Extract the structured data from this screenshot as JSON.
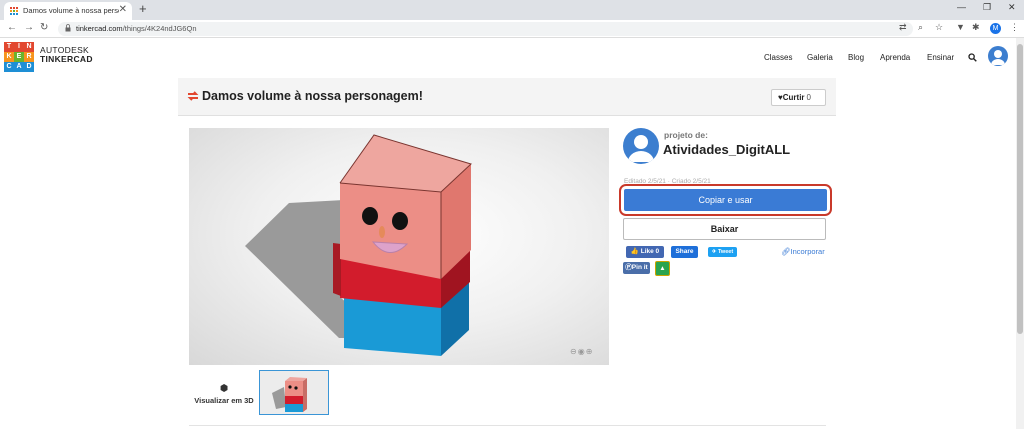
{
  "browser": {
    "tab_title": "Damos volume à nossa personag",
    "close_glyph": "✕",
    "new_tab_glyph": "+",
    "url_host": "tinkercad.com",
    "url_path": "/things/4K24ndJG6Qn",
    "profile_initial": "M",
    "window_controls": [
      "—",
      "❐",
      "✕"
    ]
  },
  "site": {
    "logo_letters": [
      "T",
      "I",
      "N",
      "K",
      "E",
      "R",
      "C",
      "A",
      "D"
    ],
    "logo_colors": [
      "#e2472f",
      "#e2472f",
      "#e2472f",
      "#f7941d",
      "#6ab42d",
      "#f7941d",
      "#1e8fd5",
      "#1e8fd5",
      "#1e8fd5"
    ],
    "brand_line1": "AUTODESK",
    "brand_line2": "TINKERCAD",
    "nav": [
      "Classes",
      "Galeria",
      "Blog",
      "Aprenda",
      "Ensinar"
    ]
  },
  "design": {
    "title": "Damos volume à nossa personagem!",
    "like_label": "Curtir",
    "like_count": "0",
    "view3d_label": "Visualizar em 3D"
  },
  "author": {
    "label": "projeto de:",
    "name": "Atividades_DigitALL",
    "dates": "Editado 2/5/21 · Criado 2/5/21"
  },
  "actions": {
    "copy_label": "Copiar e usar",
    "download_label": "Baixar",
    "fb_like_label": "Like 0",
    "share_label": "Share",
    "tweet_label": "Tweet",
    "pin_label": "Pin it",
    "embed_label": "Incorporar"
  },
  "colors": {
    "accent_blue": "#3a7bd5",
    "highlight_red": "#c9392a",
    "fb_blue": "#4267b2",
    "twitter_blue": "#1da1f2",
    "pin_blue": "#4a6ea9",
    "classroom_green": "#2aa44f"
  }
}
